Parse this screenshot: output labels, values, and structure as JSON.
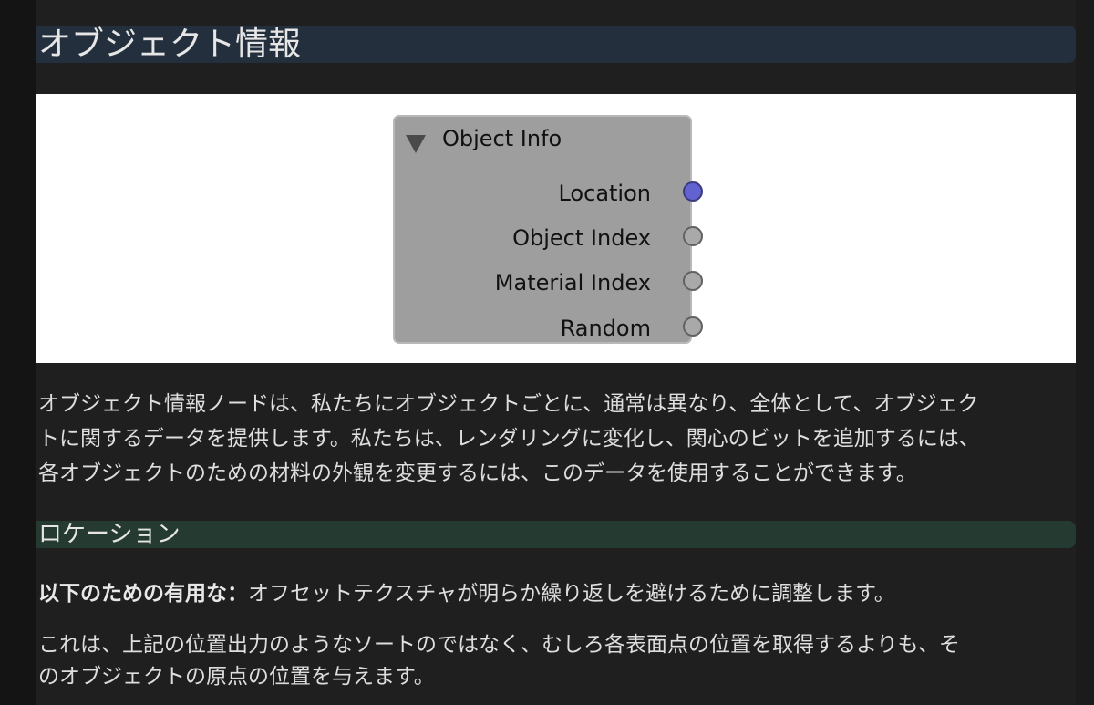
{
  "heading": "オブジェクト情報",
  "node": {
    "title": "Object Info",
    "sockets": [
      {
        "label": "Location",
        "color": "#6262d0"
      },
      {
        "label": "Object Index",
        "color": "#a9a9a9"
      },
      {
        "label": "Material Index",
        "color": "#a9a9a9"
      },
      {
        "label": "Random",
        "color": "#a9a9a9"
      }
    ]
  },
  "intro": {
    "lines": [
      "オブジェクト情報ノードは、私たちにオブジェクトごとに、通常は異なり、全体として、オブジェク",
      "トに関するデータを提供します。私たちは、レンダリングに変化し、関心のビットを追加するには、",
      "各オブジェクトのための材料の外観を変更するには、このデータを使用することができます。"
    ]
  },
  "section": {
    "title": "ロケーション",
    "useful_label": "以下のための有用な：",
    "useful_text": "オフセットテクスチャが明らか繰り返しを避けるために調整します。",
    "desc_lines": [
      "これは、上記の位置出力のようなソートのではなく、むしろ各表面点の位置を取得するよりも、そ",
      "のオブジェクトの原点の位置を与えます。"
    ]
  },
  "colors": {
    "background": "#1f1f1f",
    "h1_bg": "#232f3d",
    "h2_bg": "#253a31",
    "text": "#dedede"
  }
}
